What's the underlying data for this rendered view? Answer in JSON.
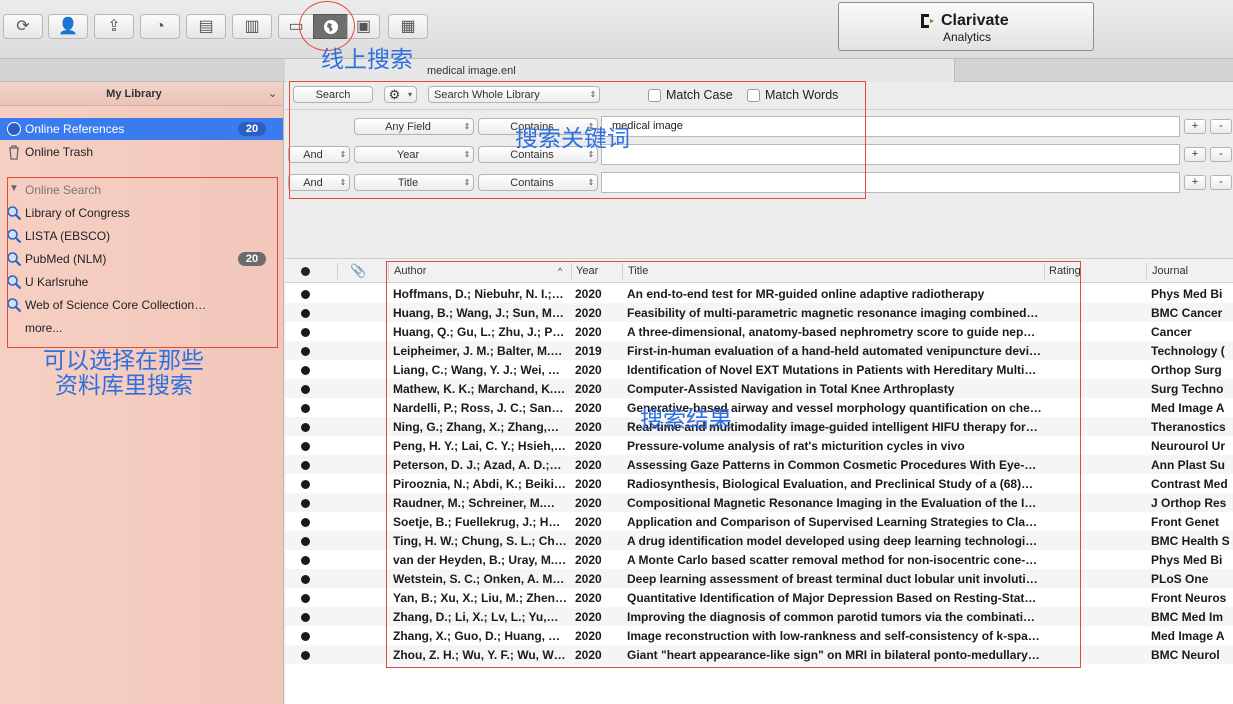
{
  "toolbar": {
    "buttons": [
      "sync-icon",
      "add-user-icon",
      "share-icon",
      "find-fulltext-icon",
      "export-icon",
      "insert-citation-icon",
      "local-library-icon",
      "online-globe-icon",
      "integrated-library-icon",
      "group-icon"
    ],
    "active": "online-globe-icon",
    "accent_color": "#3a7cf0"
  },
  "logo": {
    "name": "Clarivate",
    "sub": "Analytics"
  },
  "window": {
    "file_name": "medical image.enl"
  },
  "sidebar": {
    "header": "My Library",
    "online_references": {
      "label": "Online References",
      "count": "20"
    },
    "online_trash": {
      "label": "Online Trash"
    },
    "online_search": {
      "label": "Online Search",
      "items": [
        {
          "label": "Library of Congress",
          "count": ""
        },
        {
          "label": "LISTA (EBSCO)",
          "count": ""
        },
        {
          "label": "PubMed (NLM)",
          "count": "20"
        },
        {
          "label": "U Karlsruhe",
          "count": ""
        },
        {
          "label": "Web of Science Core Collection…",
          "count": ""
        }
      ],
      "more": "more..."
    }
  },
  "search": {
    "search_button": "Search",
    "scope": "Search Whole Library",
    "match_case": "Match Case",
    "match_words": "Match Words",
    "rows": [
      {
        "bool": "",
        "field": "Any Field",
        "op": "Contains",
        "value": "medical image"
      },
      {
        "bool": "And",
        "field": "Year",
        "op": "Contains",
        "value": ""
      },
      {
        "bool": "And",
        "field": "Title",
        "op": "Contains",
        "value": ""
      }
    ],
    "plus": "+",
    "minus": "-"
  },
  "table": {
    "columns": {
      "author": "Author",
      "year": "Year",
      "title": "Title",
      "rating": "Rating",
      "journal": "Journal"
    },
    "rows": [
      {
        "author": "Hoffmans, D.; Niebuhr, N. I.;…",
        "year": "2020",
        "title": "An end-to-end test for MR-guided online adaptive radiotherapy",
        "journal": "Phys Med Bi"
      },
      {
        "author": "Huang, B.; Wang, J.; Sun, M.…",
        "year": "2020",
        "title": "Feasibility of multi-parametric magnetic resonance imaging combined…",
        "journal": "BMC Cancer"
      },
      {
        "author": "Huang, Q.; Gu, L.; Zhu, J.; P…",
        "year": "2020",
        "title": "A three-dimensional, anatomy-based nephrometry score to guide nep…",
        "journal": "Cancer"
      },
      {
        "author": "Leipheimer, J. M.; Balter, M.…",
        "year": "2019",
        "title": "First-in-human evaluation of a hand-held automated venipuncture devi…",
        "journal": "Technology ("
      },
      {
        "author": "Liang, C.; Wang, Y. J.; Wei, Y…",
        "year": "2020",
        "title": "Identification of Novel EXT Mutations in Patients with Hereditary Multi…",
        "journal": "Orthop Surg"
      },
      {
        "author": "Mathew, K. K.; Marchand, K.…",
        "year": "2020",
        "title": "Computer-Assisted Navigation in Total Knee Arthroplasty",
        "journal": "Surg Techno"
      },
      {
        "author": "Nardelli, P.; Ross, J. C.; San…",
        "year": "2020",
        "title": "Generative-based airway and vessel morphology quantification on che…",
        "journal": "Med Image A"
      },
      {
        "author": "Ning, G.; Zhang, X.; Zhang,…",
        "year": "2020",
        "title": "Real-time and multimodality image-guided intelligent HIFU therapy for…",
        "journal": "Theranostics"
      },
      {
        "author": "Peng, H. Y.; Lai, C. Y.; Hsieh,…",
        "year": "2020",
        "title": "Pressure-volume analysis of rat's micturition cycles in vivo",
        "journal": "Neurourol Ur"
      },
      {
        "author": "Peterson, D. J.; Azad, A. D.;…",
        "year": "2020",
        "title": "Assessing Gaze Patterns in Common Cosmetic Procedures With Eye-…",
        "journal": "Ann Plast Su"
      },
      {
        "author": "Pirooznia, N.; Abdi, K.; Beiki…",
        "year": "2020",
        "title": "Radiosynthesis, Biological Evaluation, and Preclinical Study of a (68)…",
        "journal": "Contrast Med"
      },
      {
        "author": "Raudner, M.; Schreiner, M.…",
        "year": "2020",
        "title": "Compositional Magnetic Resonance Imaging in the Evaluation of the I…",
        "journal": "J Orthop Res"
      },
      {
        "author": "Soetje, B.; Fuellekrug, J.; Ha…",
        "year": "2020",
        "title": "Application and Comparison of Supervised Learning Strategies to Cla…",
        "journal": "Front Genet"
      },
      {
        "author": "Ting, H. W.; Chung, S. L.; Ch…",
        "year": "2020",
        "title": "A drug identification model developed using deep learning technologi…",
        "journal": "BMC Health S"
      },
      {
        "author": "van der Heyden, B.; Uray, M.…",
        "year": "2020",
        "title": "A Monte Carlo based scatter removal method for non-isocentric cone-…",
        "journal": "Phys Med Bi"
      },
      {
        "author": "Wetstein, S. C.; Onken, A. M.…",
        "year": "2020",
        "title": "Deep learning assessment of breast terminal duct lobular unit involuti…",
        "journal": "PLoS One"
      },
      {
        "author": "Yan, B.; Xu, X.; Liu, M.; Zhen…",
        "year": "2020",
        "title": "Quantitative Identification of Major Depression Based on Resting-Stat…",
        "journal": "Front Neuros"
      },
      {
        "author": "Zhang, D.; Li, X.; Lv, L.; Yu,…",
        "year": "2020",
        "title": "Improving the diagnosis of common parotid tumors via the combinati…",
        "journal": "BMC Med Im"
      },
      {
        "author": "Zhang, X.; Guo, D.; Huang, Y…",
        "year": "2020",
        "title": "Image reconstruction with low-rankness and self-consistency of k-spa…",
        "journal": "Med Image A"
      },
      {
        "author": "Zhou, Z. H.; Wu, Y. F.; Wu, W…",
        "year": "2020",
        "title": "Giant \"heart appearance-like sign\" on MRI in bilateral ponto-medullary…",
        "journal": "BMC Neurol"
      }
    ]
  },
  "annotations": {
    "online_search": "线上搜索",
    "keywords": "搜索关键词",
    "databases_line1": "可以选择在那些",
    "databases_line2": "资料库里搜索",
    "results": "搜索结果",
    "color": "#e24a3a",
    "text_color": "#2f6fe0"
  }
}
